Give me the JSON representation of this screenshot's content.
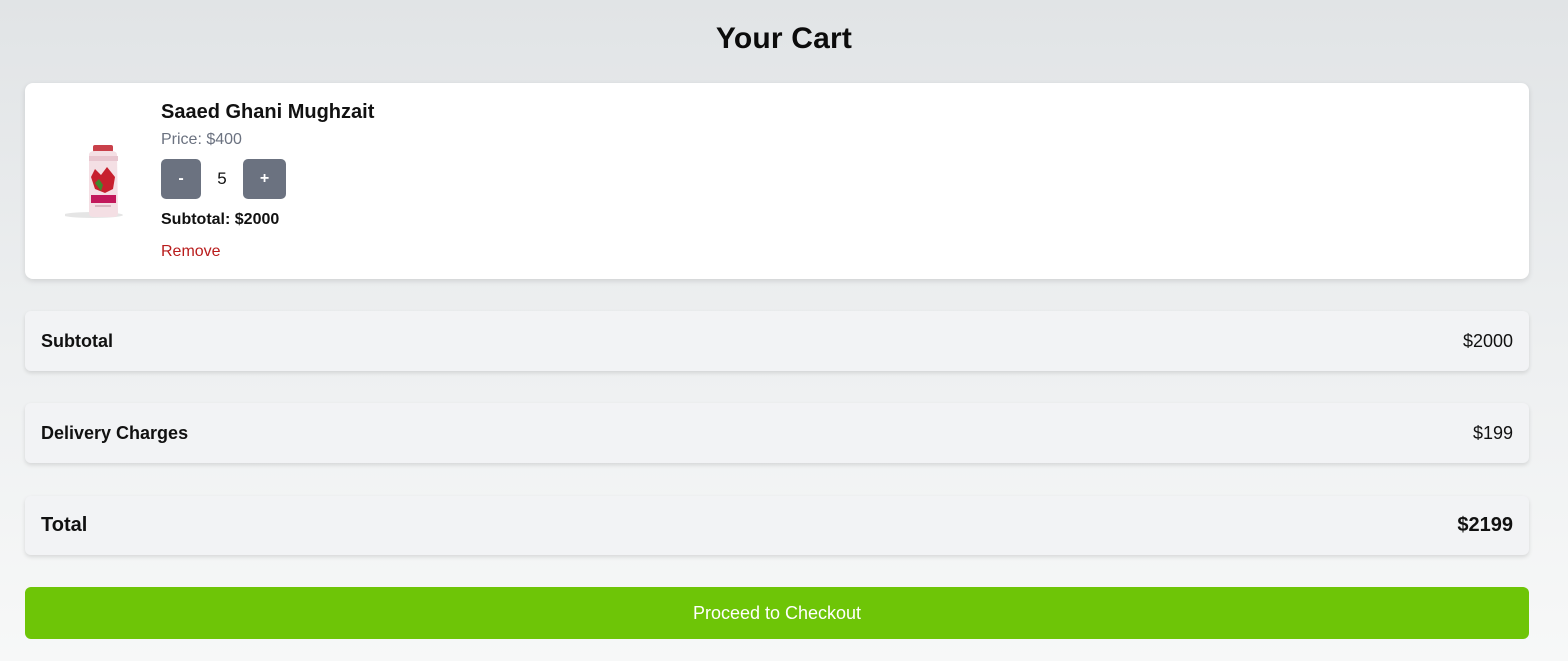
{
  "header": {
    "title": "Your Cart"
  },
  "cart": {
    "items": [
      {
        "image_icon": "shampoo-bottle-icon",
        "name": "Saaed Ghani Mughzait",
        "price_text": "Price: $400",
        "decrement_label": "-",
        "quantity": "5",
        "increment_label": "+",
        "subtotal_text": "Subtotal: $2000",
        "remove_label": "Remove"
      }
    ]
  },
  "summary": {
    "subtotal_label": "Subtotal",
    "subtotal_value": "$2000",
    "delivery_label": "Delivery Charges",
    "delivery_value": "$199",
    "total_label": "Total",
    "total_value": "$2199"
  },
  "checkout": {
    "label": "Proceed to Checkout"
  },
  "colors": {
    "checkout_green": "#6ec507",
    "qty_button_gray": "#6b7280",
    "remove_red": "#b91c1c",
    "price_gray": "#6b7280"
  }
}
